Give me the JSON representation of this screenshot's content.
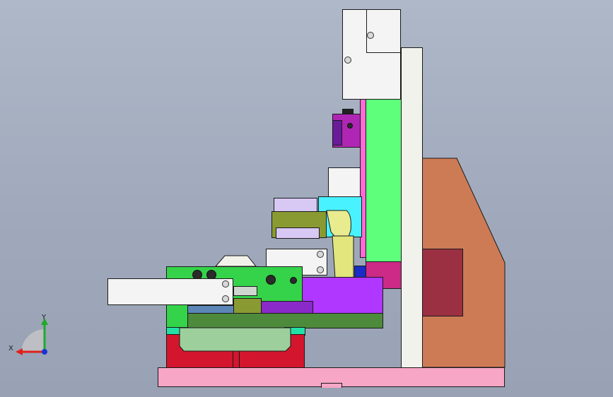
{
  "view": {
    "background_top": "#aeb8c8",
    "background_bottom": "#98a2b4"
  },
  "triad": {
    "x_label": "X",
    "y_label": "Y",
    "x_color": "#e0201c",
    "y_color": "#1faa2a",
    "z_color": "#1a33d6",
    "icon": "coordinate-triad-icon"
  },
  "colors": {
    "base_plate": "#f7a6c6",
    "red_block": "#d3152d",
    "green_plate": "#9ccf9c",
    "dark_green": "#4d8a3c",
    "teal": "#22e0a6",
    "bright_green": "#35d34a",
    "column": "#f2f2ec",
    "green_plate_vertical": "#5dff7b",
    "pink_strip": "#ff6ad6",
    "brown_bracket": "#cd7b55",
    "maroon_block": "#9b3042",
    "purple": "#b037ff",
    "magenta": "#cc2a86",
    "olive": "#8a9a32",
    "lavender": "#d8c8f4",
    "cylinder": "#f4f4f4",
    "cyan": "#48f2ff",
    "yellow": "#e9ec8e",
    "steel_blue": "#5b86b6",
    "navy": "#1a2cc7",
    "violet_block": "#8a2ac8"
  }
}
